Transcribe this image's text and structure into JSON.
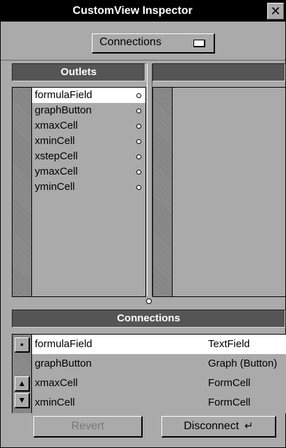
{
  "window": {
    "title": "CustomView Inspector",
    "close_glyph": "✕"
  },
  "popup": {
    "selected": "Connections"
  },
  "outlets": {
    "header": "Outlets",
    "items": [
      "formulaField",
      "graphButton",
      "xmaxCell",
      "xminCell",
      "xstepCell",
      "ymaxCell",
      "yminCell"
    ],
    "selected_index": 0
  },
  "connections": {
    "header": "Connections",
    "rows": [
      {
        "outlet": "formulaField",
        "target": "TextField"
      },
      {
        "outlet": "graphButton",
        "target": "Graph (Button)"
      },
      {
        "outlet": "xmaxCell",
        "target": "FormCell"
      },
      {
        "outlet": "xminCell",
        "target": "FormCell"
      }
    ],
    "selected_index": 0
  },
  "buttons": {
    "revert": "Revert",
    "disconnect": "Disconnect",
    "return_glyph": "↵"
  },
  "icons": {
    "scroll_up": "▲",
    "scroll_down": "▼",
    "connected_dot": "●"
  }
}
